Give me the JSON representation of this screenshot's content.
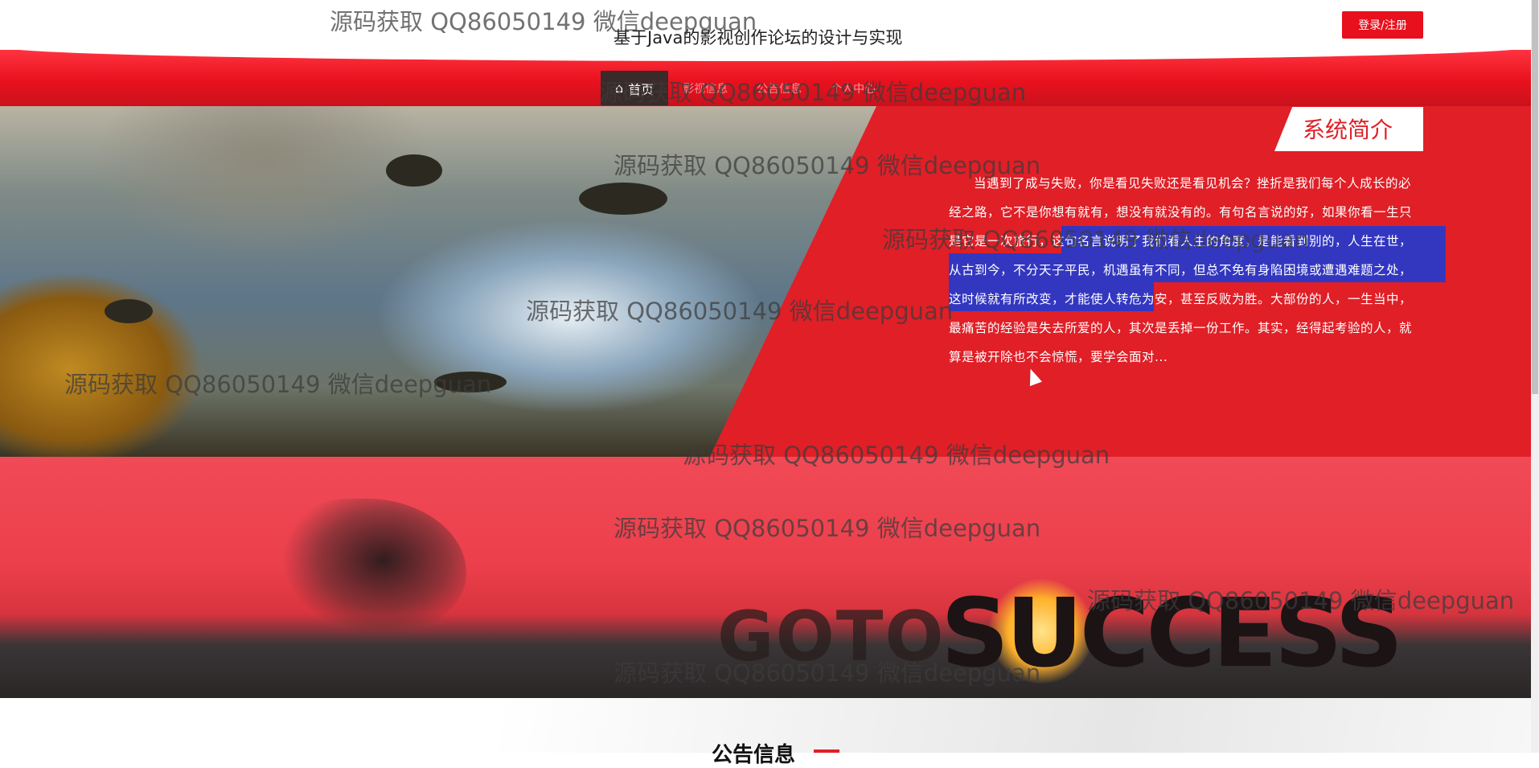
{
  "header": {
    "site_title": "基于Java的影视创作论坛的设计与实现",
    "login_label": "登录/注册"
  },
  "nav": {
    "items": [
      {
        "icon": "home-icon",
        "label": "首页"
      },
      {
        "label": "影视信息"
      },
      {
        "label": "公告信息"
      },
      {
        "label": "个人中心"
      }
    ]
  },
  "intro": {
    "title": "系统简介",
    "body": "当遇到了成与失败，你是看见失败还是看见机会？挫折是我们每个人成长的必经之路，它不是你想有就有，想没有就没有的。有句名言说的好，如果你看一生只是它是一次旅行，这句名言说明了我们看人生的角度，是能看到别的，人生在世，从古到今，不分天子平民，机遇虽有不同，但总不免有身陷困境或遭遇难题之处，这时候就有所改变，才能使人转危为安，甚至反败为胜。大部份的人，一生当中，最痛苦的经验是失去所爱的人，其次是丢掉一份工作。其实，经得起考验的人，就算是被开除也不会惊慌，要学会面对..."
  },
  "banner": {
    "goto_text": "GOTO",
    "success_text": "SUCCESS"
  },
  "notice": {
    "title": "公告信息"
  },
  "watermarks": [
    "源码获取 QQ86050149 微信deepguan",
    "源码获取 QQ86050149 微信deepguan",
    "源码获取 QQ86050149 微信deepguan",
    "源码获取 QQ86050149 微信deepguan",
    "源码获取 QQ86050149 微信deepguan",
    "源码获取 QQ86050149 微信deepguan",
    "源码获取 QQ86050149 微信deepguan",
    "源码获取 QQ86050149 微信deepguan",
    "源码获取 QQ86050149 微信deepguan",
    "源码获取 QQ86050149 微信deepguan"
  ],
  "colors": {
    "brand_red": "#e01f27",
    "selection_blue": "#1e3cdc"
  }
}
